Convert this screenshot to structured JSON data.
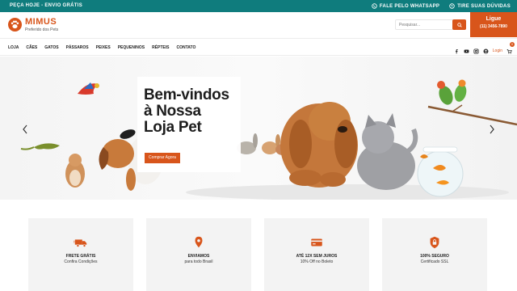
{
  "colors": {
    "accent": "#d8551b",
    "topbar": "#0f7c7d",
    "feature_bg": "#f3f3f3"
  },
  "topbar": {
    "promo": "PEÇA HOJE - ENVIO GRÁTIS",
    "whatsapp": "FALE PELO WHATSAPP",
    "help": "TIRE SUAS DÚVIDAS"
  },
  "header": {
    "brand": "MIMUS",
    "tagline": "Preferido dos Pets",
    "search_placeholder": "Pesquisar...",
    "call_label": "Ligue",
    "call_phone": "(11) 3456-7890"
  },
  "nav": {
    "items": [
      "LOJA",
      "CÃES",
      "GATOS",
      "PÁSSAROS",
      "PEIXES",
      "PEQUENINOS",
      "RÉPTEIS",
      "CONTATO"
    ],
    "login": "Login",
    "cart_count": "0",
    "social_icons": [
      "facebook-icon",
      "youtube-icon",
      "instagram-icon",
      "user-icon",
      "cart-icon"
    ]
  },
  "hero": {
    "title_lines": [
      "Bem-vindos",
      "à Nossa",
      "Loja Pet"
    ],
    "button": "Comprar Agora"
  },
  "features": [
    {
      "title": "FRETE GRÁTIS",
      "subtitle": "Confira Condições",
      "icon": "truck-icon"
    },
    {
      "title": "ENVIAMOS",
      "subtitle": "para todo Brasil",
      "icon": "location-pin-icon"
    },
    {
      "title": "ATÉ 12X SEM JUROS",
      "subtitle": "10% Off no Boleto",
      "icon": "credit-card-icon"
    },
    {
      "title": "100% SEGURO",
      "subtitle": "Certificado SSL",
      "icon": "lock-icon"
    }
  ]
}
